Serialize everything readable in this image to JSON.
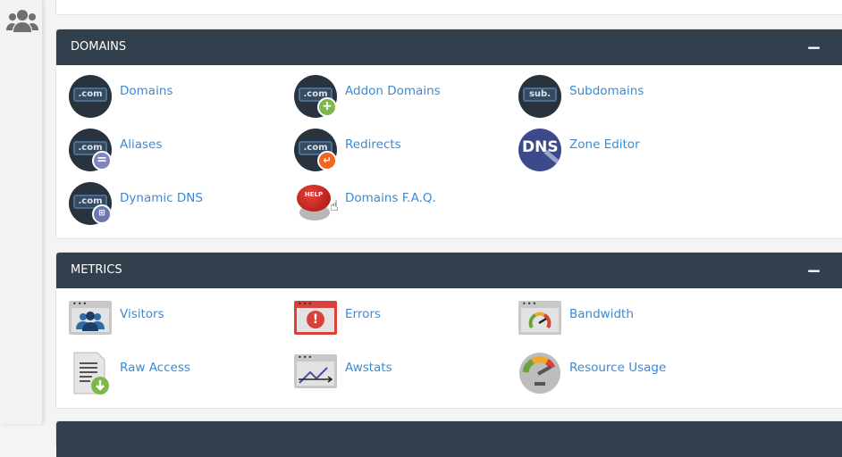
{
  "sidebar": {
    "icon": "users-icon"
  },
  "domains": {
    "title": "DOMAINS",
    "collapse": "−",
    "items": [
      {
        "label": "Domains",
        "icon": "domains-icon"
      },
      {
        "label": "Addon Domains",
        "icon": "addon-domains-icon"
      },
      {
        "label": "Subdomains",
        "icon": "subdomains-icon"
      },
      {
        "label": "Aliases",
        "icon": "aliases-icon"
      },
      {
        "label": "Redirects",
        "icon": "redirects-icon"
      },
      {
        "label": "Zone Editor",
        "icon": "zone-editor-icon"
      },
      {
        "label": "Dynamic DNS",
        "icon": "dynamic-dns-icon"
      },
      {
        "label": "Domains F.A.Q.",
        "icon": "help-button-icon"
      }
    ],
    "icon_text": {
      "com": ".com",
      "sub": "sub.",
      "dns": "DNS",
      "help": "HELP"
    }
  },
  "metrics": {
    "title": "METRICS",
    "collapse": "−",
    "items": [
      {
        "label": "Visitors",
        "icon": "visitors-icon"
      },
      {
        "label": "Errors",
        "icon": "errors-icon"
      },
      {
        "label": "Bandwidth",
        "icon": "bandwidth-icon"
      },
      {
        "label": "Raw Access",
        "icon": "raw-access-icon"
      },
      {
        "label": "Awstats",
        "icon": "awstats-icon"
      },
      {
        "label": "Resource Usage",
        "icon": "resource-usage-icon"
      }
    ]
  }
}
